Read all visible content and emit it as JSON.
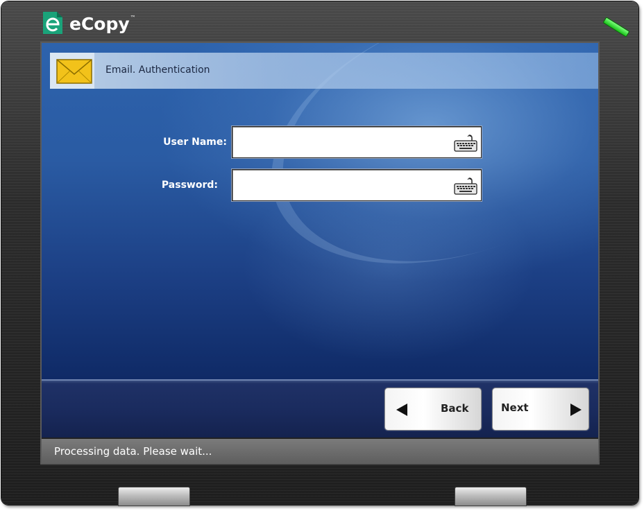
{
  "app": {
    "brand": "eCopy",
    "trademark": "™"
  },
  "header": {
    "title": "Email. Authentication",
    "icon": "envelope-icon"
  },
  "form": {
    "username": {
      "label": "User Name:",
      "value": "",
      "placeholder": ""
    },
    "password": {
      "label": "Password:",
      "value": "",
      "placeholder": ""
    },
    "keyboard_icon": "keyboard-icon"
  },
  "buttons": {
    "back_label": "Back",
    "next_label": "Next"
  },
  "status": {
    "text": "Processing data. Please wait..."
  },
  "colors": {
    "led": "#2fd62f",
    "brand_mark": "#1aa37a",
    "envelope": "#f2c21a"
  }
}
